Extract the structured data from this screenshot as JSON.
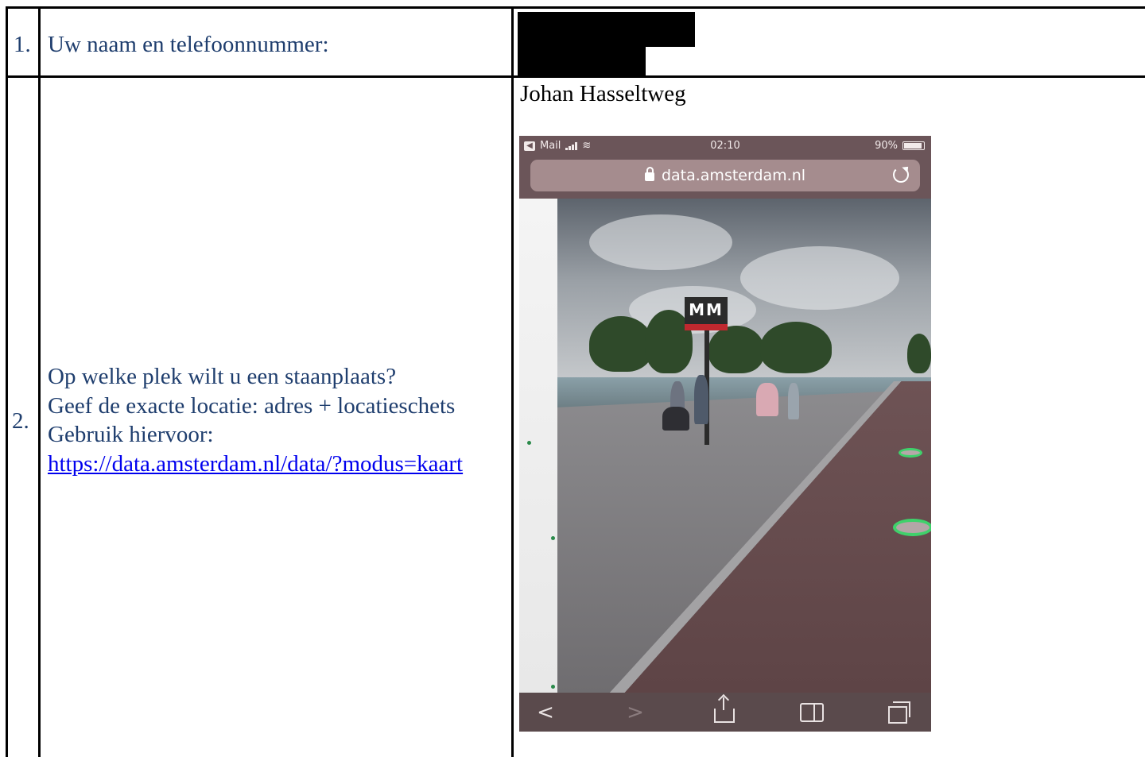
{
  "rows": [
    {
      "number": "1.",
      "question_lines": [
        "Uw naam en telefoonnummer:"
      ]
    },
    {
      "number": "2.",
      "question_lines": [
        "Op welke plek wilt u een staanplaats?",
        "Geef de exacte locatie: adres + locatieschets",
        "Gebruik hiervoor:"
      ],
      "link_text": "https://data.amsterdam.nl/data/?modus=kaart",
      "answer_text": "Johan Hasseltweg"
    }
  ],
  "phone": {
    "status": {
      "carrier": "Mail",
      "back_label": "◀",
      "time": "02:10",
      "battery": "90%"
    },
    "url": "data.amsterdam.nl",
    "metro_sign": "MM",
    "nav": {
      "back": "<",
      "forward": ">"
    }
  },
  "colors": {
    "question_text": "#1f3e6e",
    "link": "#0000ee",
    "border": "#000000"
  }
}
